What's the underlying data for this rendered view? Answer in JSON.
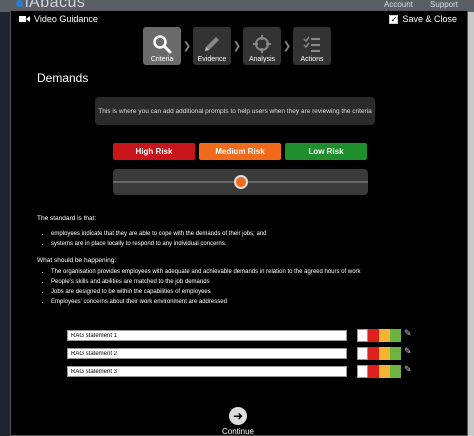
{
  "background": {
    "logo_text": "iAbacus",
    "links": [
      "Account",
      "Support"
    ]
  },
  "header": {
    "video_label": "Video Guidance",
    "save_close_label": "Save & Close"
  },
  "steps": [
    {
      "label": "Criteria",
      "icon": "search-icon"
    },
    {
      "label": "Evidence",
      "icon": "pencil-icon"
    },
    {
      "label": "Analysis",
      "icon": "crosshair-icon"
    },
    {
      "label": "Actions",
      "icon": "checklist-icon"
    }
  ],
  "page_title": "Demands",
  "prompt_text": "This is where you can add additional prompts to help users when they are reviewing the criteria",
  "risk_buttons": [
    {
      "label": "High Risk",
      "color": "#c8151b",
      "text_color": "#ffffff"
    },
    {
      "label": "Medium Risk",
      "color": "#f26a1b",
      "text_color": "#ffffff"
    },
    {
      "label": "Low Risk",
      "color": "#1e8f2c",
      "text_color": "#ffffff"
    }
  ],
  "slider": {
    "value": 0.5,
    "knob_color": "#f26a1b"
  },
  "standard": {
    "heading": "The standard is that:",
    "items": [
      "employees indicate that they are able to cope with the demands of their jobs; and",
      "systems are in place locally to respond to any individual concerns."
    ]
  },
  "happening": {
    "heading": "What should be happening:",
    "items": [
      "The organisation provides employees with adequate and achievable demands in relation to the agreed hours of work",
      "People's skills and abilities are matched to the job demands",
      "Jobs are designed to be within the capabilities of employees",
      "Employees' concerns about their work environment are addressed"
    ]
  },
  "rag_statements": [
    {
      "value": "RAG statement 1"
    },
    {
      "value": "RAG statement 2"
    },
    {
      "value": "RAG statement 3"
    }
  ],
  "rag_colors": [
    "#ffffff",
    "#e02020",
    "#f2b431",
    "#6cb33f"
  ],
  "continue_label": "Continue"
}
